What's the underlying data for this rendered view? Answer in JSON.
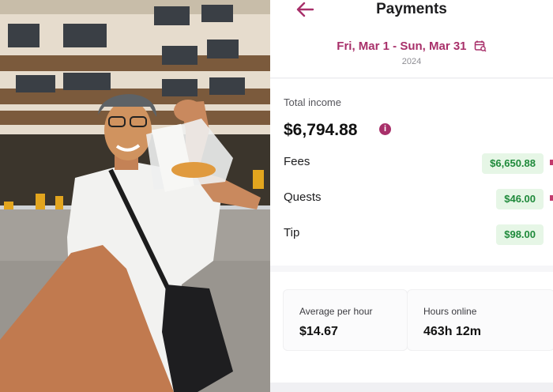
{
  "header": {
    "title": "Payments",
    "back_icon": "arrow-left-icon"
  },
  "period": {
    "range_label": "Fri, Mar 1 - Sun, Mar 31",
    "year": "2024",
    "calendar_icon": "calendar-search-icon"
  },
  "income": {
    "total_label": "Total income",
    "total_value": "$6,794.88",
    "info_icon": "info-icon",
    "rows": [
      {
        "label": "Fees",
        "amount": "$6,650.88"
      },
      {
        "label": "Quests",
        "amount": "$46.00"
      },
      {
        "label": "Tip",
        "amount": "$98.00"
      }
    ]
  },
  "stats": {
    "avg_label": "Average per hour",
    "avg_value": "$14.67",
    "hours_label": "Hours online",
    "hours_value": "463h 12m"
  },
  "colors": {
    "accent": "#a8306a",
    "positive_bg": "#e6f6e6",
    "positive_text": "#1f8a3b"
  },
  "photo": {
    "description_icon": "person-holding-food-bag-photo"
  }
}
